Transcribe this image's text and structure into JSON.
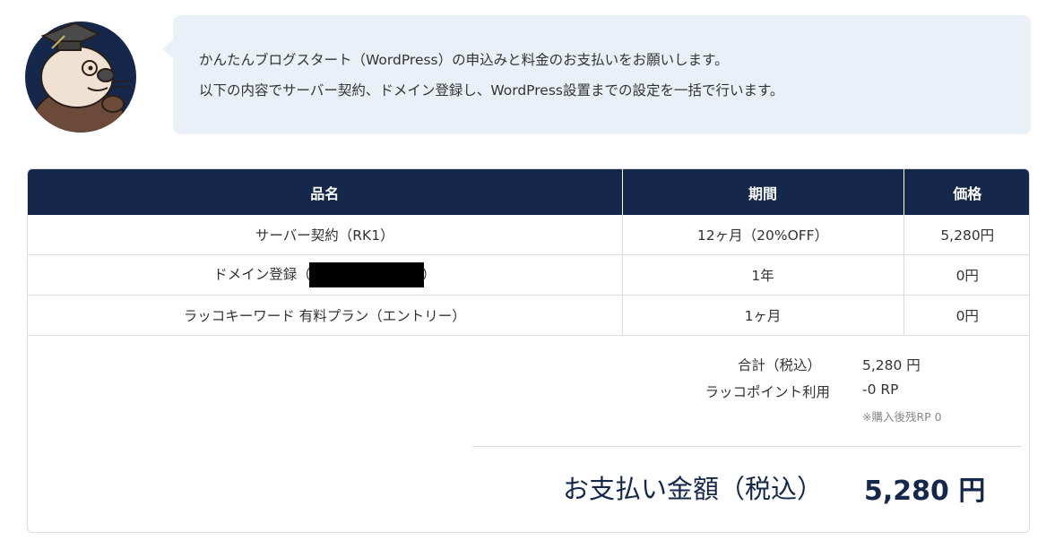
{
  "intro": {
    "line1": "かんたんブログスタート（WordPress）の申込みと料金のお支払いをお願いします。",
    "line2": "以下の内容でサーバー契約、ドメイン登録し、WordPress設置までの設定を一括で行います。"
  },
  "table": {
    "headers": [
      "品名",
      "期間",
      "価格"
    ],
    "rows": [
      {
        "name": "サーバー契約（RK1）",
        "period": "12ヶ月（20%OFF）",
        "price": "5,280円"
      },
      {
        "name_prefix": "ドメイン登録（",
        "name_suffix": "）",
        "period": "1年",
        "price": "0円"
      },
      {
        "name": "ラッコキーワード 有料プラン（エントリー）",
        "period": "1ヶ月",
        "price": "0円"
      }
    ]
  },
  "summary": {
    "subtotal_label": "合計（税込）",
    "subtotal_value": "5,280 円",
    "points_label": "ラッコポイント利用",
    "points_value": "-0 RP",
    "points_note": "※購入後残RP 0",
    "total_label": "お支払い金額（税込）",
    "total_value": "5,280 円"
  },
  "colors": {
    "header_bg": "#15284b",
    "bubble_bg": "#eaf0f8"
  },
  "icons": {
    "mascot": "sea-otter-graduate-avatar"
  }
}
